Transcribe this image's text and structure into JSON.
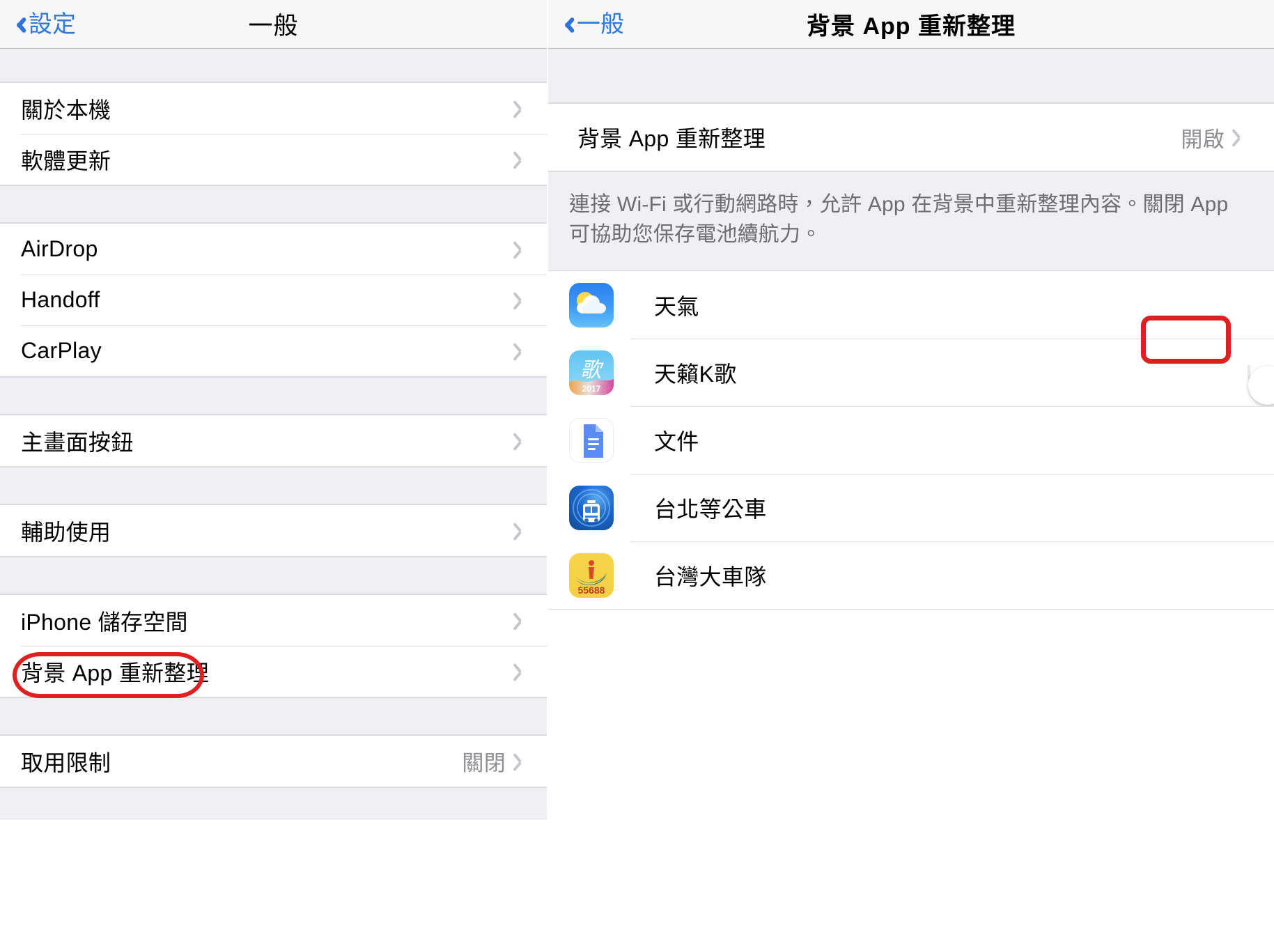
{
  "left_panel": {
    "navbar": {
      "back_label": "設定",
      "title": "一般"
    },
    "groups": [
      {
        "rows": [
          {
            "label": "關於本機",
            "value": "",
            "chevron": true
          },
          {
            "label": "軟體更新",
            "value": "",
            "chevron": true
          }
        ]
      },
      {
        "rows": [
          {
            "label": "AirDrop",
            "value": "",
            "chevron": true
          },
          {
            "label": "Handoff",
            "value": "",
            "chevron": true
          },
          {
            "label": "CarPlay",
            "value": "",
            "chevron": true
          }
        ]
      },
      {
        "rows": [
          {
            "label": "主畫面按鈕",
            "value": "",
            "chevron": true
          }
        ]
      },
      {
        "rows": [
          {
            "label": "輔助使用",
            "value": "",
            "chevron": true
          }
        ]
      },
      {
        "rows": [
          {
            "label": "iPhone 儲存空間",
            "value": "",
            "chevron": true
          },
          {
            "label": "背景 App 重新整理",
            "value": "",
            "chevron": true,
            "highlighted": true
          }
        ]
      },
      {
        "rows": [
          {
            "label": "取用限制",
            "value": "關閉",
            "chevron": true
          }
        ]
      }
    ]
  },
  "right_panel": {
    "navbar": {
      "back_label": "一般",
      "title": "背景 App 重新整理"
    },
    "master_row": {
      "label": "背景 App 重新整理",
      "value": "開啟",
      "chevron": true
    },
    "footer_note": "連接 Wi-Fi 或行動網路時，允許 App 在背景中重新整理內容。關閉 App 可協助您保存電池續航力。",
    "apps": [
      {
        "name": "天氣",
        "icon": "weather-app-icon",
        "enabled": true,
        "highlighted": true
      },
      {
        "name": "天籟K歌",
        "icon": "karaoke-app-icon",
        "enabled": false,
        "highlighted": false
      },
      {
        "name": "文件",
        "icon": "google-docs-app-icon",
        "enabled": true,
        "highlighted": false
      },
      {
        "name": "台北等公車",
        "icon": "taipei-bus-app-icon",
        "enabled": true,
        "highlighted": false
      },
      {
        "name": "台灣大車隊",
        "icon": "taiwan-taxi-app-icon",
        "enabled": true,
        "highlighted": false
      }
    ],
    "karaoke_icon_year": "2017",
    "taxi_icon_number": "55688"
  },
  "colors": {
    "accent_blue": "#3278dc",
    "switch_on_green": "#5fd068",
    "highlight_red": "#e02020",
    "group_bg": "#efeff4",
    "secondary_text": "#8e8e93"
  }
}
